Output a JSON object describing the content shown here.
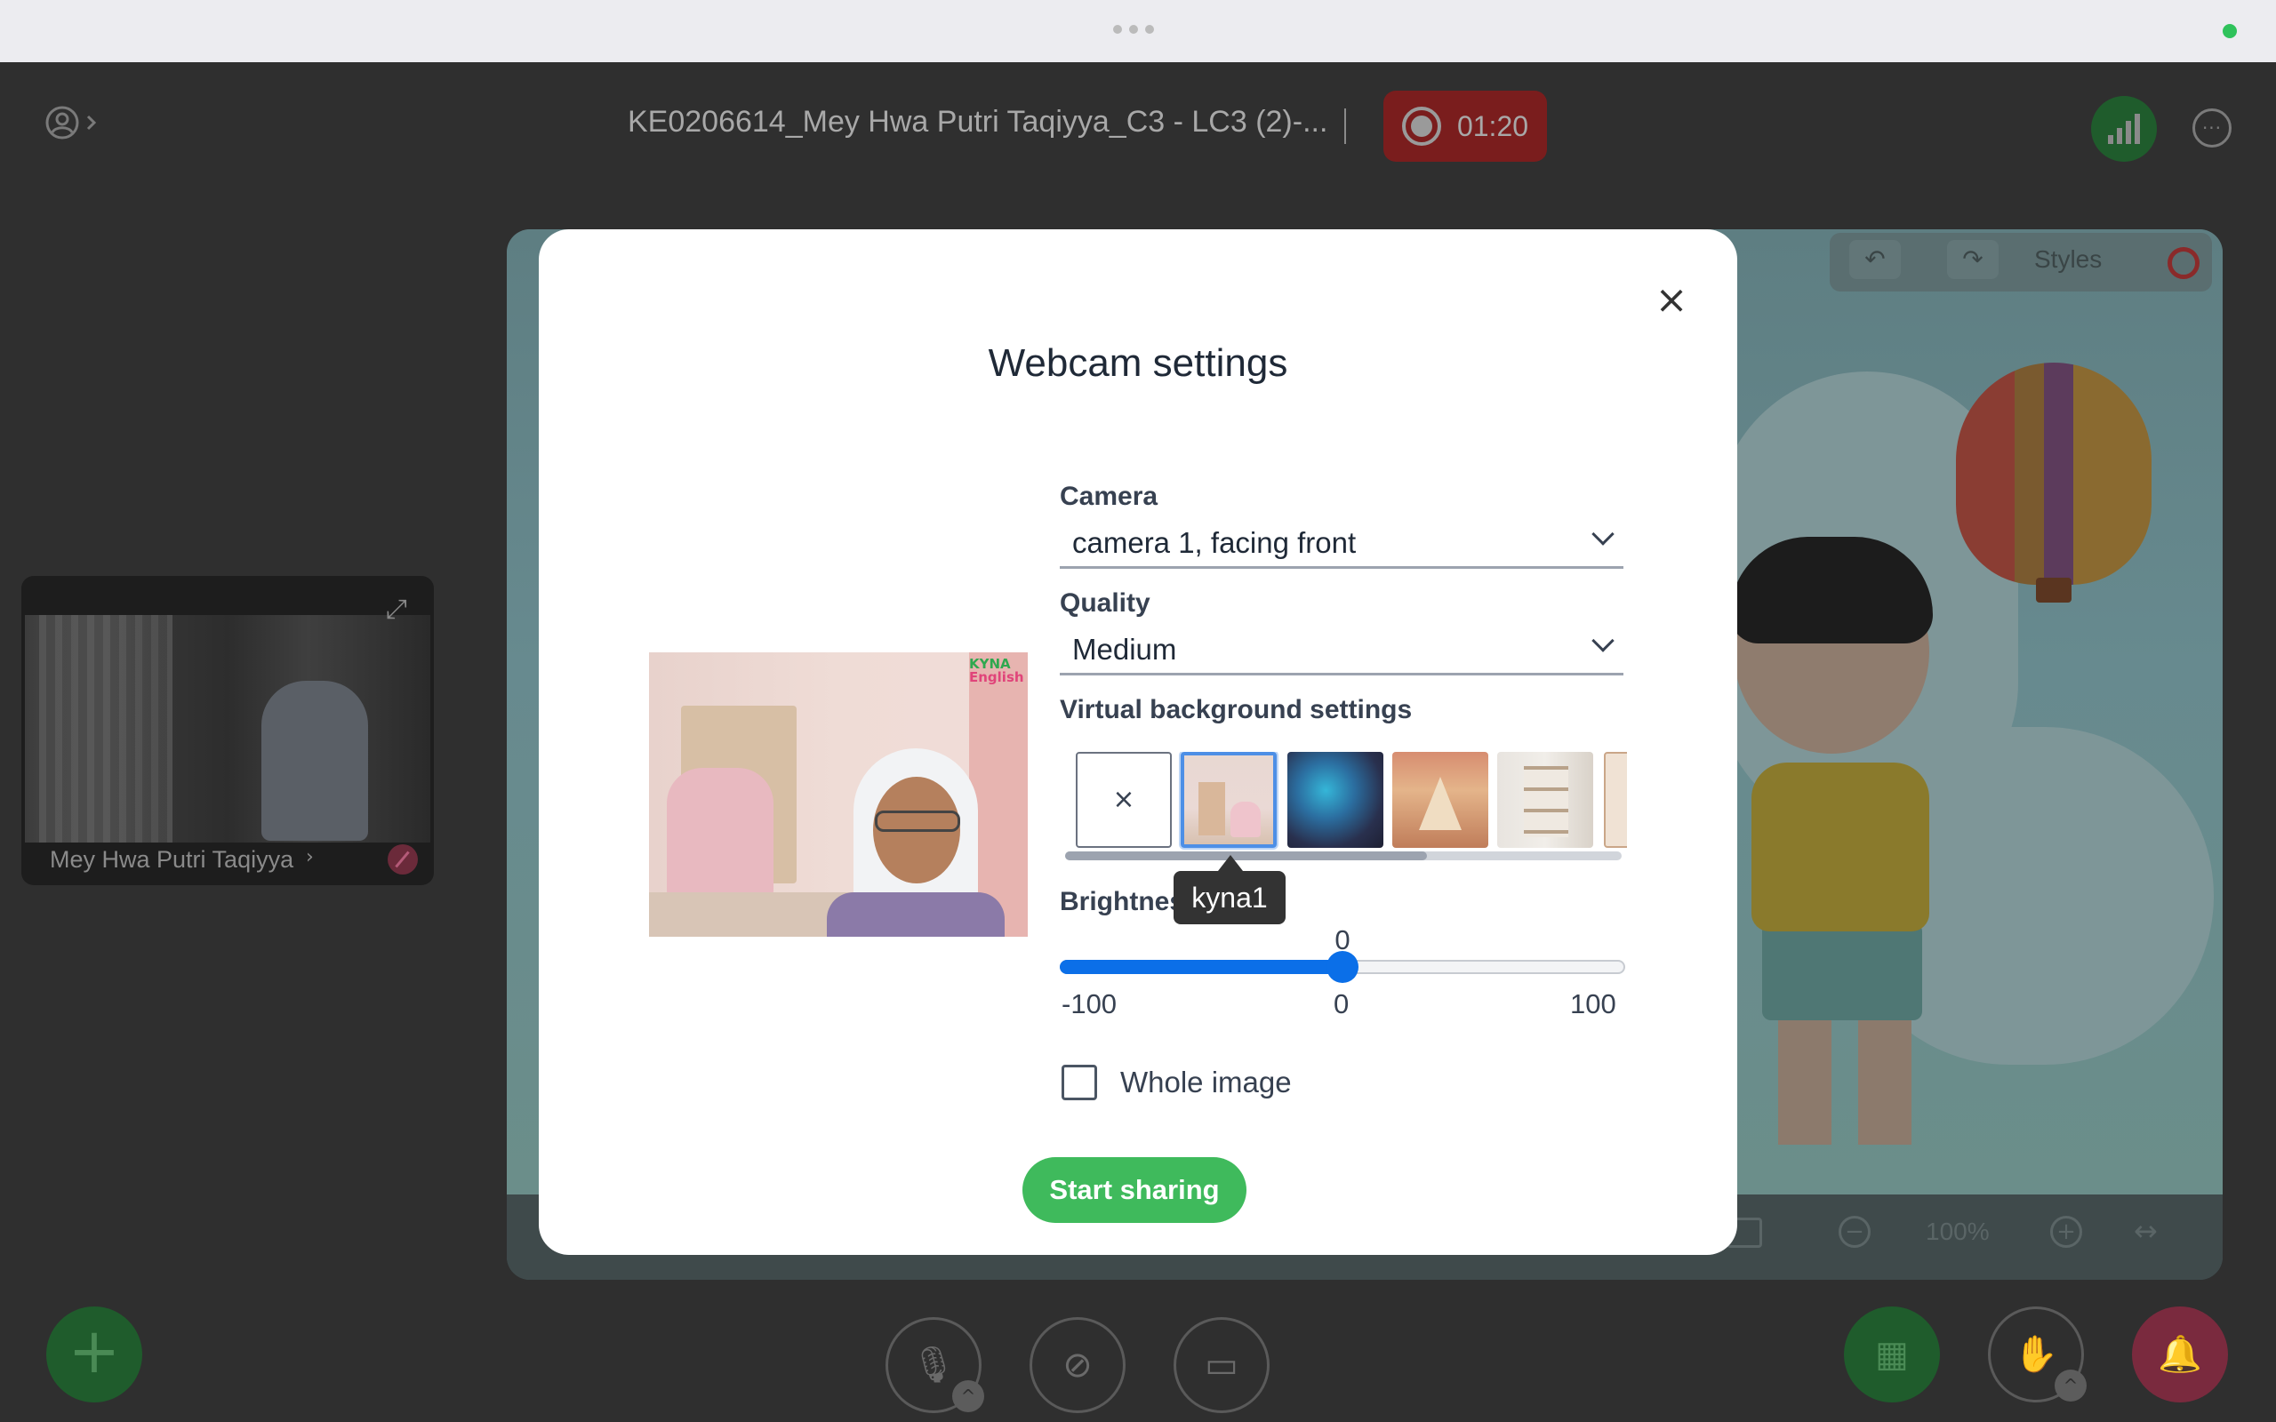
{
  "window": {
    "status_color": "#2fc25b"
  },
  "header": {
    "meeting_title": "KE0206614_Mey Hwa Putri Taqiyya_C3 - LC3 (2)-...",
    "recording_time": "01:20",
    "recording_color": "#7a1d1d",
    "icons": {
      "user_menu": "user-circle-icon",
      "signal": "signal-bars-icon",
      "more": "more-options-icon"
    }
  },
  "video_tile": {
    "participant_name": "Mey Hwa Putri Taqiyya",
    "name_chevron": "›",
    "expand_icon": "expand-icon",
    "mic_status": "muted"
  },
  "whiteboard": {
    "styles_label": "Styles",
    "zoom_level": "100%",
    "undo_icon": "↶",
    "redo_icon": "↷",
    "zoom_out": "−",
    "zoom_in": "+",
    "fit_width": "↔"
  },
  "bottom_bar": {
    "add_icon": "+",
    "mic_icon": "mic-off-icon",
    "camera_icon": "camera-off-icon",
    "screen_icon": "screen-share-off-icon",
    "present_icon": "presentation-icon",
    "hand_icon": "raise-hand-icon",
    "alert_icon": "alert-bell-icon",
    "accent_green": "#3fba5c"
  },
  "modal": {
    "title": "Webcam settings",
    "close_label": "×",
    "camera": {
      "label": "Camera",
      "value": "camera 1, facing front"
    },
    "quality": {
      "label": "Quality",
      "value": "Medium"
    },
    "virtual_background": {
      "label": "Virtual background settings",
      "none_label": "×",
      "selected": "kyna1",
      "scroll_fraction_visible": 0.65,
      "options": [
        "none",
        "kyna1",
        "blur",
        "tent-room",
        "bookshelf",
        "partial"
      ]
    },
    "tooltip": "kyna1",
    "brightness": {
      "label": "Brightnes",
      "value_label": "0",
      "value": 0,
      "min": -100,
      "max": 100,
      "min_label": "-100",
      "mid_label": "0",
      "max_label": "100"
    },
    "whole_image": {
      "label": "Whole image",
      "checked": false
    },
    "start_button": "Start sharing",
    "preview": {
      "logo_line1": "KYNA",
      "logo_line2": "English"
    }
  }
}
